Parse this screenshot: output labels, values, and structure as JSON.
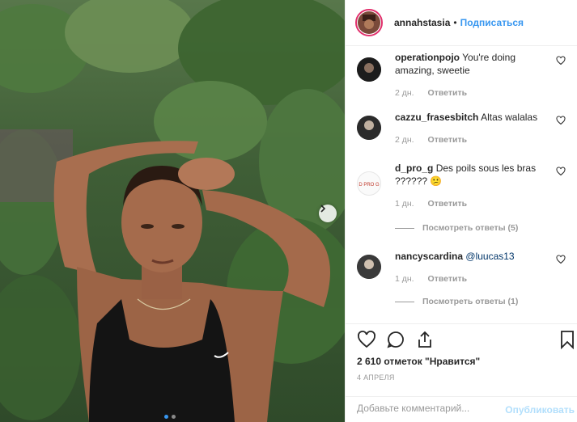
{
  "post": {
    "author": "annahstasia",
    "separator": "•",
    "follow_label": "Подписаться",
    "likes_text": "2 610 отметок \"Нравится\"",
    "date_text": "4 АПРЕЛЯ",
    "carousel": {
      "slides": 2,
      "active": 1
    }
  },
  "comments": [
    {
      "user": "operationpojo",
      "text": "You're doing amazing, sweetie",
      "age": "2 дн.",
      "reply": "Ответить",
      "avatar_color": "#1c1c1c"
    },
    {
      "user": "cazzu_frasesbitch",
      "text": "Altas walalas",
      "age": "2 дн.",
      "reply": "Ответить",
      "avatar_color": "#2b2b2b"
    },
    {
      "user": "d_pro_g",
      "text": "Des poils sous les bras ?????? 😕",
      "age": "1 дн.",
      "reply": "Ответить",
      "avatar_color": "#f5f5f5",
      "avatar_text": "D PRO G",
      "view_replies": "Посмотреть ответы (5)"
    },
    {
      "user": "nancyscardina",
      "text": "@luucas13",
      "age": "1 дн.",
      "reply": "Ответить",
      "avatar_color": "#3a3a3a",
      "view_replies": "Посмотреть ответы (1)"
    }
  ],
  "add_comment": {
    "placeholder": "Добавьте комментарий...",
    "publish_label": "Опубликовать"
  },
  "colors": {
    "link": "#3897f0",
    "publish_disabled": "#b2dffc",
    "text": "#262626",
    "muted": "#999999"
  }
}
